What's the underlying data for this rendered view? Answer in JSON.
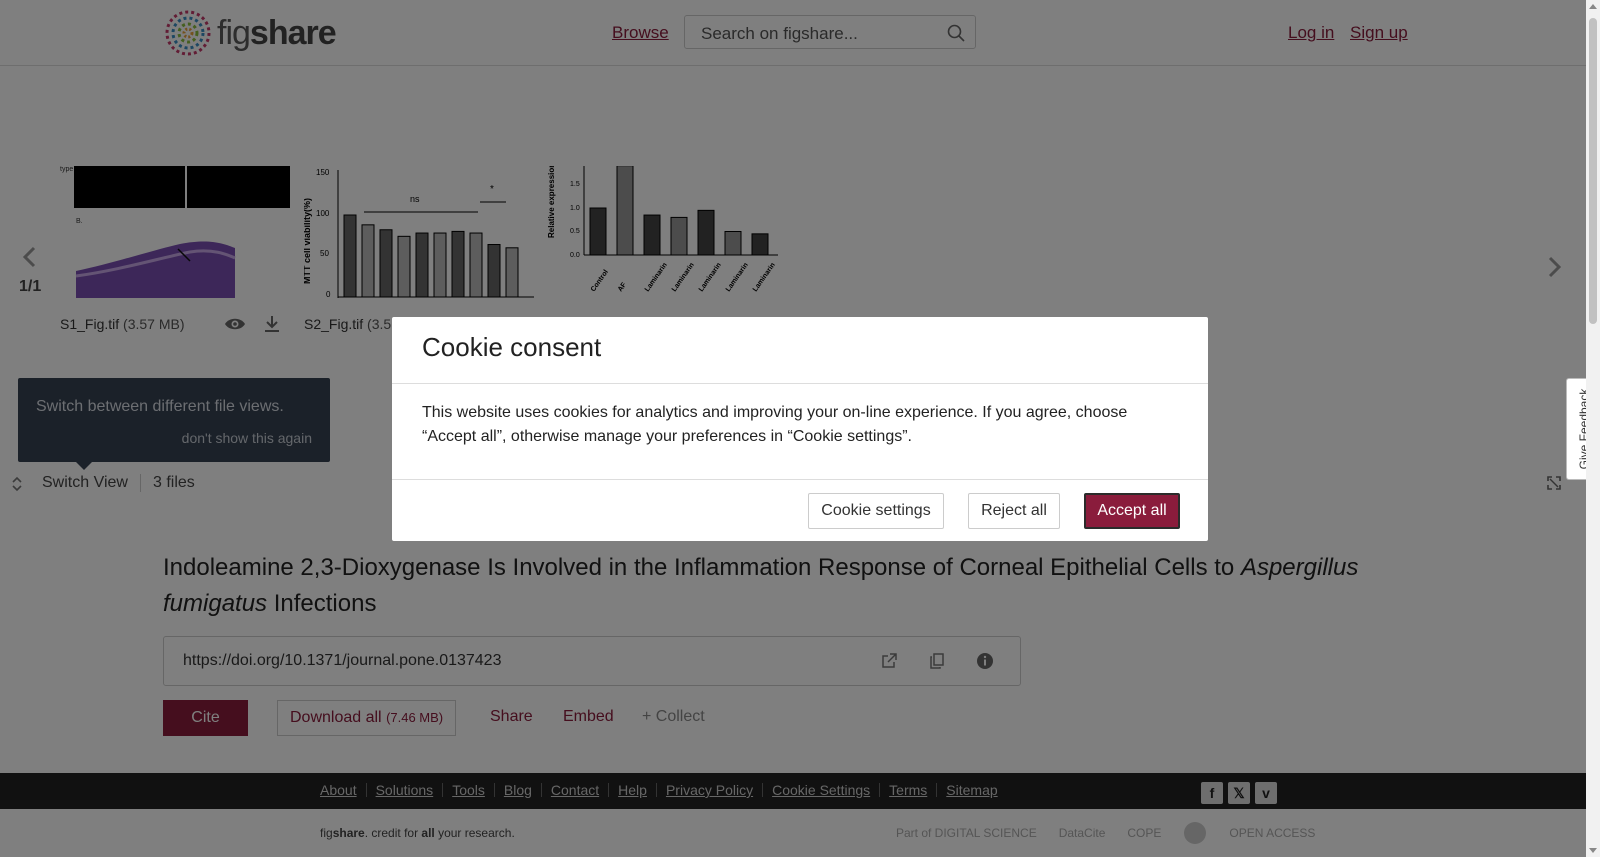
{
  "header": {
    "logo_text_a": "fig",
    "logo_text_b": "share",
    "browse": "Browse",
    "search_placeholder": "Search on figshare...",
    "login": "Log in",
    "signup": "Sign up"
  },
  "viewer": {
    "counter": "1/1",
    "files": [
      {
        "name": "S1_Fig.tif",
        "size": "(3.57 MB)"
      },
      {
        "name": "S2_Fig.tif",
        "size": "(3.5"
      }
    ],
    "tooltip": {
      "text": "Switch between different file views.",
      "dismiss": "don't show this again"
    },
    "switch_view": "Switch View",
    "file_count": "3 files"
  },
  "chart_thumb": {
    "s2_ylabel": "MTT cell viability(%)",
    "s2_ticks": [
      "150",
      "100",
      "50",
      "0"
    ],
    "s2_ns": "ns",
    "s2_star": "*",
    "s3_ylabel": "Relative expression of IDO mRNA",
    "s3_ticks": [
      "1.5",
      "1.0",
      "0.5",
      "0.0"
    ],
    "s3_labels": [
      "Control",
      "AF",
      "Laminarin",
      "Laminarin",
      "Laminarin",
      "Laminarin",
      "Laminarin"
    ]
  },
  "article": {
    "title_part1": "Indoleamine 2,3-Dioxygenase Is Involved in the Inflammation Response of Corneal Epithelial Cells to ",
    "title_italic": "Aspergillus fumigatus",
    "title_part2": " Infections",
    "doi": "https://doi.org/10.1371/journal.pone.0137423",
    "cite": "Cite",
    "download_all": "Download all",
    "download_size": "(7.46 MB)",
    "share": "Share",
    "embed": "Embed",
    "collect": "+ Collect"
  },
  "footer": {
    "links": [
      "About",
      "Solutions",
      "Tools",
      "Blog",
      "Contact",
      "Help",
      "Privacy Policy",
      "Cookie Settings",
      "Terms",
      "Sitemap"
    ],
    "credit_fig": "fig",
    "credit_share": "share",
    "credit_mid": ". credit for ",
    "credit_all": "all",
    "credit_end": " your research.",
    "partners": [
      "Part of DIGITAL SCIENCE",
      "DataCite",
      "COPE",
      "",
      "OPEN ACCESS"
    ]
  },
  "cookie_modal": {
    "title": "Cookie consent",
    "body": "This website uses cookies for analytics and improving your on-line experience. If you agree, choose “Accept all”, otherwise manage your preferences in “Cookie settings”.",
    "settings": "Cookie settings",
    "reject": "Reject all",
    "accept": "Accept all"
  },
  "feedback": "Give Feedback",
  "colors": {
    "accent": "#8a1c3c",
    "footer": "#222222",
    "tooltip": "#374252"
  }
}
